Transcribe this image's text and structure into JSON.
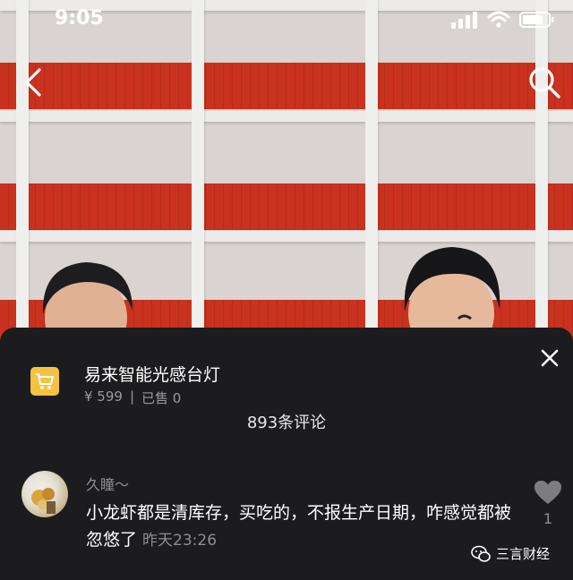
{
  "status_bar": {
    "time": "9:05"
  },
  "product": {
    "title": "易来智能光感台灯",
    "price": "¥ 599",
    "separator": "|",
    "sold": "已售 0"
  },
  "comments": {
    "count_label": "893条评论",
    "items": [
      {
        "username": "久瞳～",
        "text": "小龙虾都是清库存，买吃的，不报生产日期，咋感觉都被忽悠了",
        "time": "昨天23:26",
        "likes": "1"
      }
    ]
  },
  "watermark": {
    "text": "三言财经"
  },
  "icons": {
    "back": "chevron-left-icon",
    "search": "search-icon",
    "cart": "cart-icon",
    "close": "close-icon",
    "like": "heart-icon"
  },
  "colors": {
    "panel_bg": "#1c1c1e",
    "cart_badge": "#f6c242",
    "muted_text": "#8e8e93"
  }
}
